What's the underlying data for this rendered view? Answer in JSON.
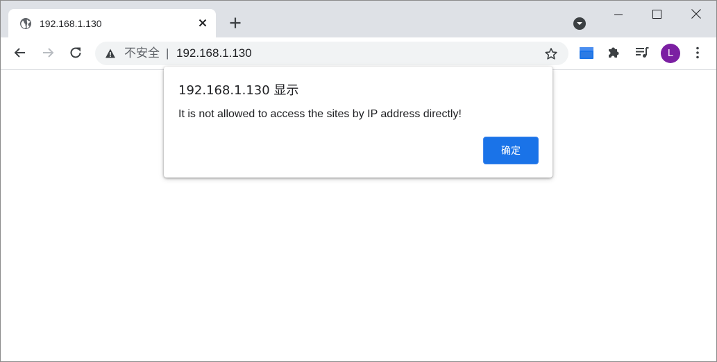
{
  "tab": {
    "title": "192.168.1.130",
    "favicon_icon": "globe-icon",
    "close_icon": "close-icon"
  },
  "tabstrip": {
    "new_tab_icon": "plus-icon",
    "tab_search_icon": "chevron-down-circle-icon"
  },
  "window_controls": {
    "minimize_icon": "minimize-icon",
    "maximize_icon": "maximize-icon",
    "close_icon": "close-icon"
  },
  "toolbar": {
    "back_icon": "arrow-left-icon",
    "forward_icon": "arrow-right-icon",
    "reload_icon": "reload-icon",
    "extension1_icon": "extension-box-icon",
    "extensions_icon": "puzzle-icon",
    "media_icon": "media-queue-icon",
    "menu_icon": "kebab-menu-icon"
  },
  "omnibox": {
    "security_icon": "warning-icon",
    "security_label": "不安全",
    "separator": "|",
    "url": "192.168.1.130",
    "bookmark_icon": "star-icon"
  },
  "profile": {
    "initial": "L"
  },
  "dialog": {
    "title": "192.168.1.130 显示",
    "message": "It is not allowed to access the sites by IP address directly!",
    "ok_label": "确定"
  },
  "colors": {
    "tabstrip_bg": "#dee1e6",
    "omnibox_bg": "#f1f3f4",
    "accent_blue": "#1a73e8",
    "avatar_purple": "#7b1fa2",
    "icon_gray": "#5f6368"
  }
}
